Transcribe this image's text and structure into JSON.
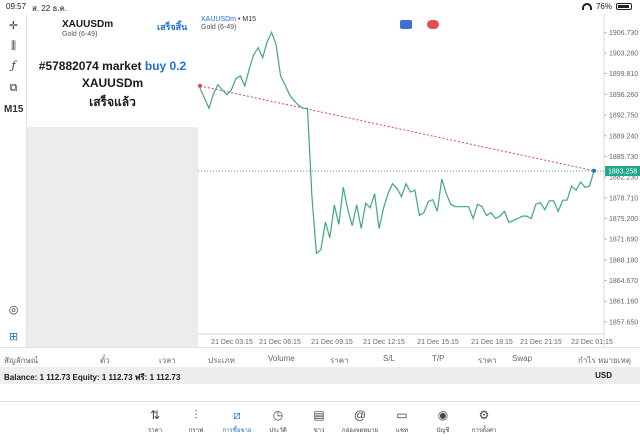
{
  "status": {
    "time": "09:57",
    "date": "ส. 22 ธ.ค.",
    "battery": "76%"
  },
  "toolbar": {
    "timeframe": "M15"
  },
  "symbol_panel": {
    "symbol": "XAUUSDm",
    "description": "Gold (6-49)",
    "done_label": "เสร็จสิ้น",
    "order_prefix": "#57882074 market",
    "order_side": "buy 0.2",
    "order_symbol": "XAUUSDm",
    "order_status": "เสร็จแล้ว"
  },
  "chart_legend": {
    "symbol": "XAUUSDm",
    "timeframe": "• M15",
    "description": "Gold (6-49)"
  },
  "chart_data": {
    "type": "line",
    "x": [
      "21 Dec 03:15",
      "21 Dec 06:15",
      "21 Dec 09:15",
      "21 Dec 12:15",
      "21 Dec 15:15",
      "21 Dec 18:15",
      "21 Dec 21:15",
      "22 Dec 01:15"
    ],
    "values": [
      1897.3,
      1895.6,
      1893.9,
      1896.3,
      1897.9,
      1897.0,
      1896.2,
      1897.0,
      1898.9,
      1899.4,
      1897.7,
      1900.6,
      1903.0,
      1904.2,
      1902.5,
      1905.2,
      1906.8,
      1904.7,
      1899.4,
      1897.9,
      1896.2,
      1895.2,
      1894.4,
      1893.9,
      1893.9,
      1879.0,
      1869.3,
      1869.9,
      1874.6,
      1871.9,
      1877.5,
      1874.2,
      1880.5,
      1876.7,
      1874.0,
      1877.5,
      1873.5,
      1877.8,
      1877.0,
      1879.4,
      1873.5,
      1877.0,
      1879.4,
      1881.1,
      1880.3,
      1878.9,
      1881.1,
      1879.7,
      1880.0,
      1875.7,
      1876.2,
      1878.1,
      1878.4,
      1876.4,
      1881.9,
      1879.4,
      1877.6,
      1877.2,
      1877.2,
      1877.2,
      1877.2,
      1875.2,
      1877.6,
      1877.2,
      1875.7,
      1876.2,
      1875.2,
      1875.6,
      1876.4,
      1874.5,
      1874.9,
      1875.2,
      1875.6,
      1875.6,
      1875.2,
      1877.6,
      1877.9,
      1876.7,
      1878.2,
      1878.2,
      1876.4,
      1878.3,
      1878.3,
      1880.7,
      1880.0,
      1881.4,
      1880.5,
      1880.7,
      1883.3
    ],
    "ylim": [
      1855.6,
      1909.9
    ],
    "y_ticks": [
      1906.73,
      1903.28,
      1899.81,
      1896.26,
      1892.75,
      1889.24,
      1885.73,
      1882.23,
      1878.71,
      1875.2,
      1871.69,
      1868.18,
      1864.67,
      1861.16,
      1857.65
    ],
    "current_price": "1883.258",
    "current_price_value": 1883.258,
    "entry_price": 1897.7,
    "grid": false,
    "colors": {
      "line": "#3fa87a",
      "trend": "#d94a4a",
      "price_line": "#3fa87a",
      "price_label_bg": "#1fa88a"
    }
  },
  "positions_header": {
    "columns": [
      "สัญลักษณ์",
      "ตั๋ว",
      "เวลา",
      "ประเภท",
      "Volume",
      "ราคา",
      "S/L",
      "T/P",
      "ราคา",
      "Swap",
      "กำไร",
      "หมายเหตุ"
    ]
  },
  "balance": {
    "text": "Balance: 1 112.73 Equity: 1 112.73 ฟรี: 1 112.73",
    "currency": "USD"
  },
  "tabs": [
    {
      "icon": "quotes-icon",
      "label": "ราคา"
    },
    {
      "icon": "chart-icon",
      "label": "กราฟ"
    },
    {
      "icon": "trade-icon",
      "label": "การซื้อขาย",
      "active": true
    },
    {
      "icon": "history-icon",
      "label": "ประวัติ"
    },
    {
      "icon": "news-icon",
      "label": "ข่าว"
    },
    {
      "icon": "mailbox-icon",
      "label": "กล่องจดหมาย"
    },
    {
      "icon": "chat-icon",
      "label": "แชท"
    },
    {
      "icon": "account-icon",
      "label": "บัญชี"
    },
    {
      "icon": "settings-icon",
      "label": "การตั้งค่า"
    }
  ]
}
